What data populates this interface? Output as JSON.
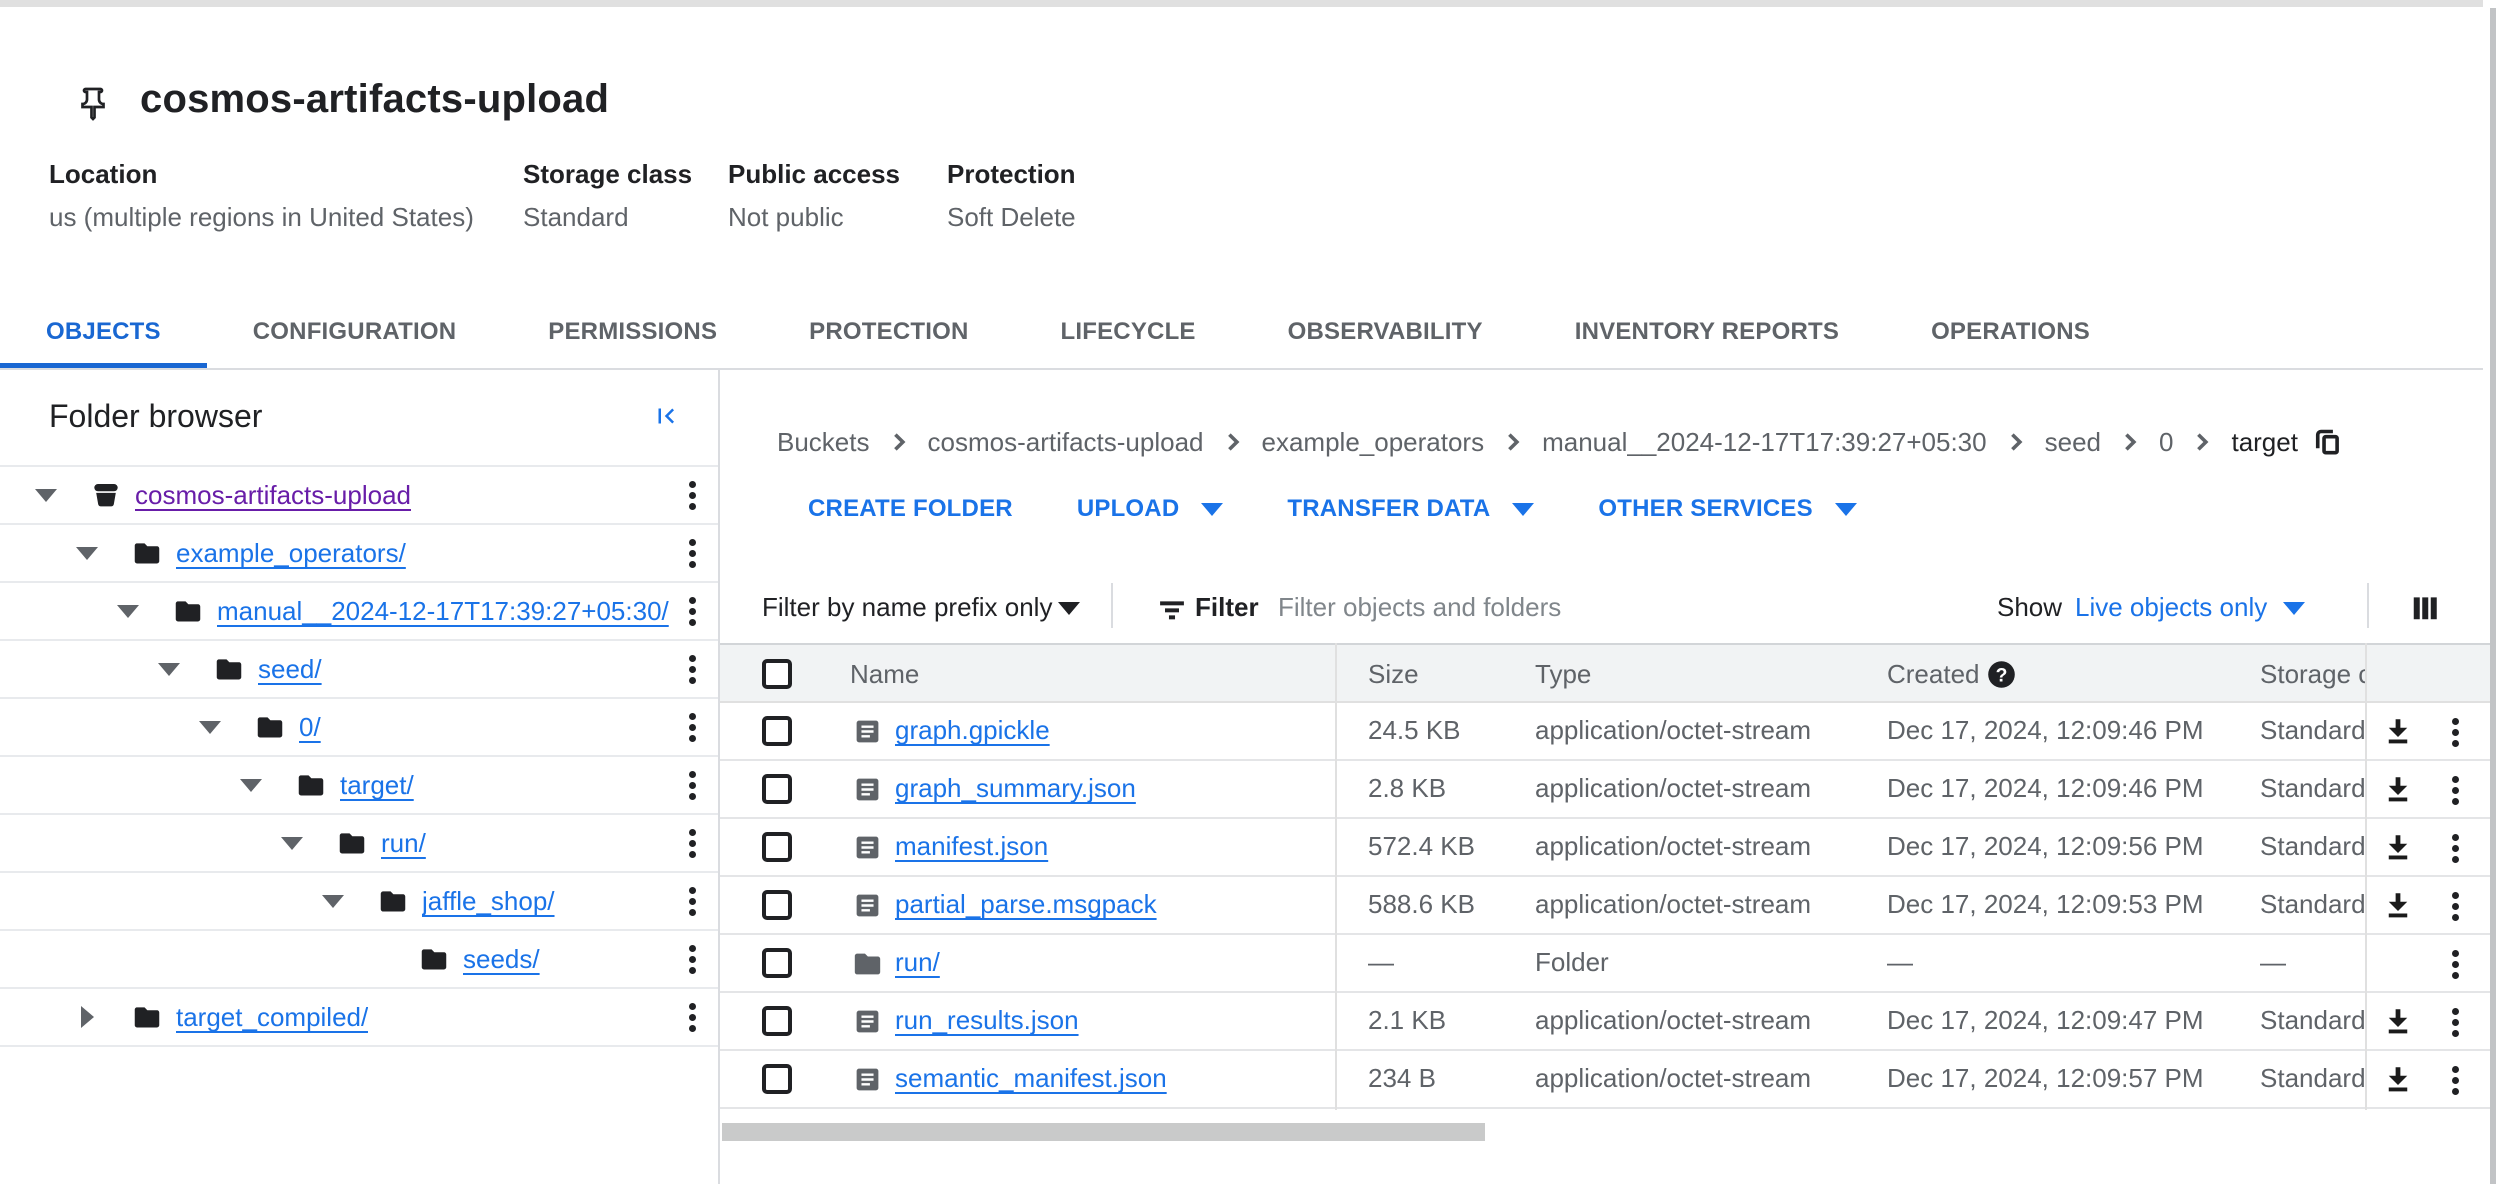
{
  "page": {
    "title": "cosmos-artifacts-upload"
  },
  "metadata": {
    "fields": [
      {
        "label": "Location",
        "value": "us (multiple regions in United States)"
      },
      {
        "label": "Storage class",
        "value": "Standard"
      },
      {
        "label": "Public access",
        "value": "Not public"
      },
      {
        "label": "Protection",
        "value": "Soft Delete"
      }
    ]
  },
  "tabs": {
    "items": [
      {
        "label": "OBJECTS",
        "active": true
      },
      {
        "label": "CONFIGURATION",
        "active": false
      },
      {
        "label": "PERMISSIONS",
        "active": false
      },
      {
        "label": "PROTECTION",
        "active": false
      },
      {
        "label": "LIFECYCLE",
        "active": false
      },
      {
        "label": "OBSERVABILITY",
        "active": false
      },
      {
        "label": "INVENTORY REPORTS",
        "active": false
      },
      {
        "label": "OPERATIONS",
        "active": false
      }
    ]
  },
  "folder_browser": {
    "title": "Folder browser",
    "collapse_icon": "collapse-panel-icon",
    "tree": [
      {
        "name": "cosmos-artifacts-upload",
        "level": 0,
        "icon": "bucket",
        "caret": "expanded",
        "visited": true
      },
      {
        "name": "example_operators/",
        "level": 1,
        "icon": "folder",
        "caret": "expanded",
        "visited": false
      },
      {
        "name": "manual__2024-12-17T17:39:27+05:30/",
        "level": 2,
        "icon": "folder",
        "caret": "expanded",
        "visited": false
      },
      {
        "name": "seed/",
        "level": 3,
        "icon": "folder",
        "caret": "expanded",
        "visited": false
      },
      {
        "name": "0/",
        "level": 4,
        "icon": "folder",
        "caret": "expanded",
        "visited": false
      },
      {
        "name": "target/",
        "level": 5,
        "icon": "folder",
        "caret": "expanded",
        "visited": false
      },
      {
        "name": "run/",
        "level": 6,
        "icon": "folder",
        "caret": "expanded",
        "visited": false
      },
      {
        "name": "jaffle_shop/",
        "level": 7,
        "icon": "folder",
        "caret": "expanded",
        "visited": false
      },
      {
        "name": "seeds/",
        "level": 8,
        "icon": "folder",
        "caret": "none",
        "visited": false
      },
      {
        "name": "target_compiled/",
        "level": 1,
        "icon": "folder",
        "caret": "collapsed",
        "visited": false
      }
    ]
  },
  "breadcrumb": {
    "items": [
      "Buckets",
      "cosmos-artifacts-upload",
      "example_operators",
      "manual__2024-12-17T17:39:27+05:30",
      "seed",
      "0",
      "target"
    ]
  },
  "actions": {
    "buttons": [
      {
        "label": "CREATE FOLDER",
        "caret": false
      },
      {
        "label": "UPLOAD",
        "caret": true
      },
      {
        "label": "TRANSFER DATA",
        "caret": true
      },
      {
        "label": "OTHER SERVICES",
        "caret": true
      }
    ]
  },
  "filter_bar": {
    "prefix_label": "Filter by name prefix only",
    "filter_label": "Filter",
    "placeholder": "Filter objects and folders",
    "show_label": "Show",
    "show_value": "Live objects only"
  },
  "table": {
    "columns": {
      "name": "Name",
      "size": "Size",
      "type": "Type",
      "created": "Created",
      "storage": "Storage class"
    },
    "rows": [
      {
        "name": "graph.gpickle",
        "size": "24.5 KB",
        "type": "application/octet-stream",
        "created": "Dec 17, 2024, 12:09:46 PM",
        "storage": "Standard",
        "folder": false
      },
      {
        "name": "graph_summary.json",
        "size": "2.8 KB",
        "type": "application/octet-stream",
        "created": "Dec 17, 2024, 12:09:46 PM",
        "storage": "Standard",
        "folder": false
      },
      {
        "name": "manifest.json",
        "size": "572.4 KB",
        "type": "application/octet-stream",
        "created": "Dec 17, 2024, 12:09:56 PM",
        "storage": "Standard",
        "folder": false
      },
      {
        "name": "partial_parse.msgpack",
        "size": "588.6 KB",
        "type": "application/octet-stream",
        "created": "Dec 17, 2024, 12:09:53 PM",
        "storage": "Standard",
        "folder": false
      },
      {
        "name": "run/",
        "size": "—",
        "type": "Folder",
        "created": "—",
        "storage": "—",
        "folder": true
      },
      {
        "name": "run_results.json",
        "size": "2.1 KB",
        "type": "application/octet-stream",
        "created": "Dec 17, 2024, 12:09:47 PM",
        "storage": "Standard",
        "folder": false
      },
      {
        "name": "semantic_manifest.json",
        "size": "234 B",
        "type": "application/octet-stream",
        "created": "Dec 17, 2024, 12:09:57 PM",
        "storage": "Standard",
        "folder": false
      }
    ]
  },
  "colors": {
    "link_blue": "#1a73e8",
    "tab_blue": "#1967d2",
    "visited_purple": "#681da8",
    "ink": "#202124",
    "gray": "#5f6368",
    "border": "#dadce0"
  }
}
